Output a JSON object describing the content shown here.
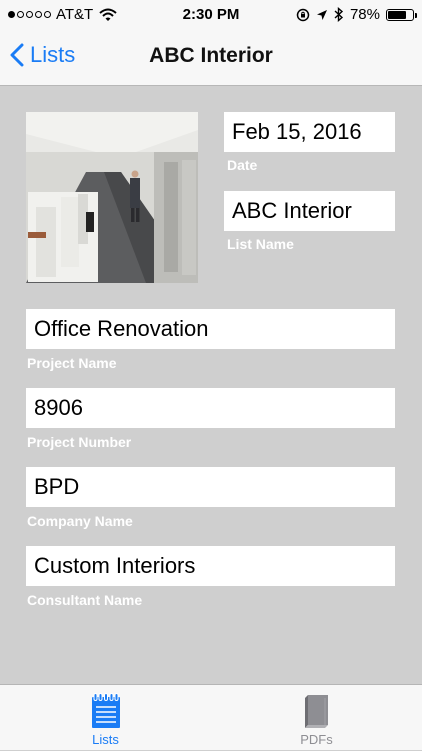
{
  "status_bar": {
    "carrier": "AT&T",
    "time": "2:30 PM",
    "battery": "78%",
    "battery_level": 0.78,
    "signal_bars_filled": 1,
    "signal_bars_total": 5
  },
  "nav": {
    "back_label": "Lists",
    "title": "ABC Interior",
    "accent_color": "#1a7cf5"
  },
  "form": {
    "date_value": "Feb 15, 2016",
    "date_label": "Date",
    "list_name_value": "ABC Interior",
    "list_name_label": "List Name",
    "project_name_value": "Office Renovation",
    "project_name_label": "Project Name",
    "project_number_value": "8906",
    "project_number_label": "Project Number",
    "company_name_value": "BPD",
    "company_name_label": "Company Name",
    "consultant_name_value": "Custom Interiors",
    "consultant_name_label": "Consultant Name"
  },
  "tabs": [
    {
      "label": "Lists",
      "icon": "notepad-icon",
      "active": true,
      "color": "#1a7cf5"
    },
    {
      "label": "PDFs",
      "icon": "pdf-book-icon",
      "active": false,
      "color": "#8e8e93"
    }
  ]
}
